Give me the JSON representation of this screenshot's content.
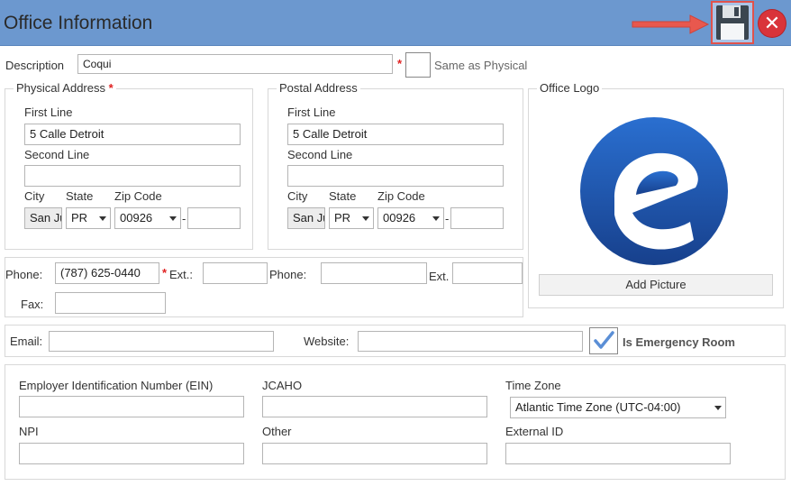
{
  "window": {
    "title": "Office Information"
  },
  "toolbar": {
    "save_icon": "floppy-disk-icon",
    "close_icon": "close-icon"
  },
  "description": {
    "label": "Description",
    "value": "Coqui",
    "required_mark": "*",
    "same_label": "Same as Physical"
  },
  "physical": {
    "legend": "Physical Address",
    "required_mark": "*",
    "first_label": "First Line",
    "first_value": "5 Calle Detroit",
    "second_label": "Second Line",
    "second_value": "",
    "city_label": "City",
    "city_value": "San Ju",
    "state_label": "State",
    "state_value": "PR",
    "zip_label": "Zip Code",
    "zip_value": "00926",
    "dash": "-",
    "zip_ext": ""
  },
  "postal": {
    "legend": "Postal Address",
    "first_label": "First Line",
    "first_value": "5 Calle Detroit",
    "second_label": "Second Line",
    "second_value": "",
    "city_label": "City",
    "city_value": "San Ju",
    "state_label": "State",
    "state_value": "PR",
    "zip_label": "Zip Code",
    "zip_value": "00926",
    "dash": "-",
    "zip_ext": ""
  },
  "logo": {
    "legend": "Office Logo",
    "add_label": "Add Picture"
  },
  "phones": {
    "phone_label": "Phone:",
    "phone_value": "(787) 625-0440",
    "req": "*",
    "ext_label": "Ext.:",
    "ext_value": "",
    "phone2_label": "Phone:",
    "phone2_value": "",
    "ext2_label": "Ext.",
    "ext2_value": "",
    "fax_label": "Fax:",
    "fax_value": ""
  },
  "contact": {
    "email_label": "Email:",
    "email_value": "",
    "website_label": "Website:",
    "website_value": "",
    "er_label": "Is Emergency Room",
    "er_checked": true
  },
  "ids": {
    "ein_label": "Employer Identification Number (EIN)",
    "ein_value": "",
    "jcaho_label": "JCAHO",
    "jcaho_value": "",
    "tz_label": "Time Zone",
    "tz_value": "Atlantic Time Zone (UTC-04:00)",
    "npi_label": "NPI",
    "npi_value": "",
    "other_label": "Other",
    "other_value": "",
    "extid_label": "External ID",
    "extid_value": ""
  },
  "colors": {
    "titlebar": "#6c98cf",
    "required": "#e02020",
    "logo_blue": "#1f5bb4",
    "highlight": "#e0524c"
  }
}
